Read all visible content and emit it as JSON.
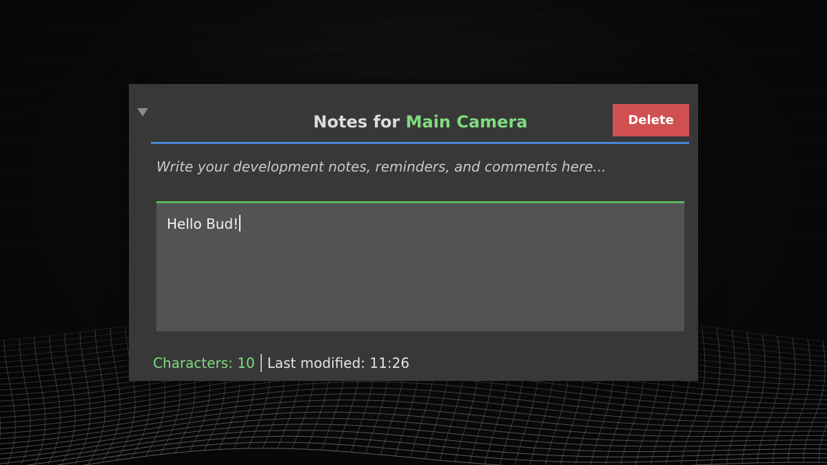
{
  "inspector": {
    "title_prefix": "Notes for ",
    "target_name": "Main Camera",
    "delete_label": "Delete",
    "help_text": "Write your development notes, reminders, and comments here...",
    "note_text": "Hello Bud!",
    "characters_label": "Characters: 10",
    "last_modified_label": "Last modified: 11:26"
  },
  "icons": {
    "foldout": "triangle-down-icon"
  },
  "colors": {
    "panel_bg": "#383838",
    "editor_bg": "#535353",
    "accent_blue": "#4a86d6",
    "accent_green": "#7fdc7f",
    "delete_red": "#d05052"
  }
}
